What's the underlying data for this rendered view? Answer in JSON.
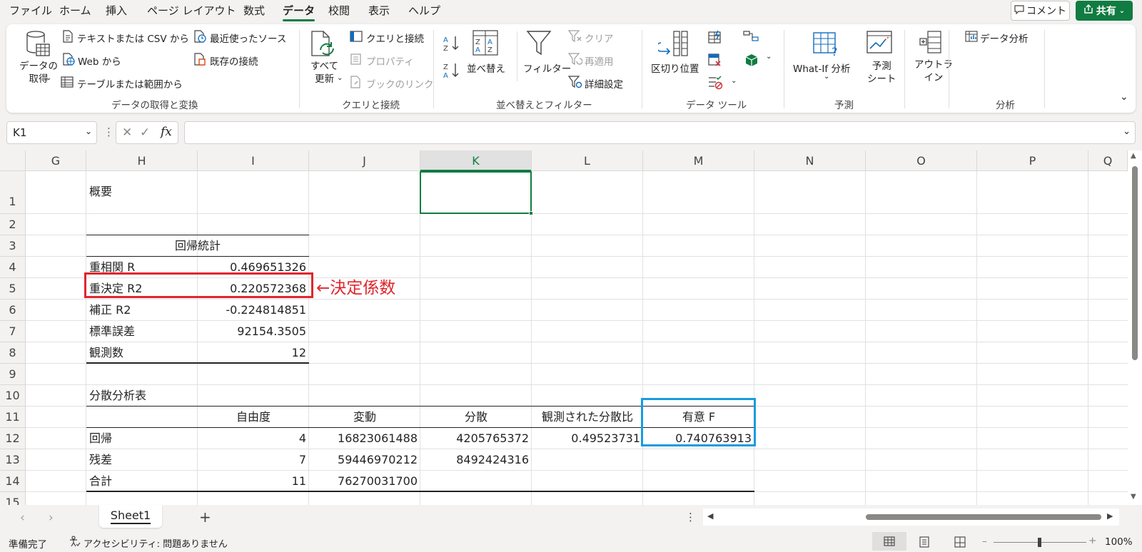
{
  "menu": {
    "items": [
      "ファイル",
      "ホーム",
      "挿入",
      "ページ レイアウト",
      "数式",
      "データ",
      "校閲",
      "表示",
      "ヘルプ"
    ],
    "active": "データ",
    "comment_label": "コメント",
    "share_label": "共有"
  },
  "ribbon": {
    "get_data": "データの\n取得",
    "text_csv": "テキストまたは CSV から",
    "web": "Web から",
    "table_range": "テーブルまたは範囲から",
    "recent_sources": "最近使ったソース",
    "existing_connections": "既存の接続",
    "group_get_transform": "データの取得と変換",
    "refresh_all": "すべて\n更新",
    "queries_connections": "クエリと接続",
    "properties": "プロパティ",
    "workbook_links": "ブックのリンク",
    "group_queries": "クエリと接続",
    "sort": "並べ替え",
    "filter": "フィルター",
    "clear": "クリア",
    "reapply": "再適用",
    "advanced": "詳細設定",
    "group_sort_filter": "並べ替えとフィルター",
    "text_to_columns": "区切り位置",
    "group_data_tools": "データ ツール",
    "what_if": "What-If 分析",
    "forecast_sheet": "予測\nシート",
    "group_forecast": "予測",
    "outline": "アウトラ\nイン",
    "data_analysis": "データ分析",
    "group_analysis": "分析"
  },
  "formula_bar": {
    "name_box": "K1",
    "fx": "fx",
    "formula": ""
  },
  "columns": [
    "G",
    "H",
    "I",
    "J",
    "K",
    "L",
    "M",
    "N",
    "O",
    "P",
    "Q"
  ],
  "selected_column": "K",
  "rows": [
    "1",
    "2",
    "3",
    "4",
    "5",
    "6",
    "7",
    "8",
    "9",
    "10",
    "11",
    "12",
    "13",
    "14",
    "15"
  ],
  "cells": {
    "h1": "概要",
    "h3": "回帰統計",
    "h4": "重相関 R",
    "i4": "0.469651326",
    "h5": "重決定 R2",
    "i5": "0.220572368",
    "h6": "補正 R2",
    "i6": "-0.224814851",
    "h7": "標準誤差",
    "i7": "92154.3505",
    "h8": "観測数",
    "i8": "12",
    "h10": "分散分析表",
    "i11": "自由度",
    "j11": "変動",
    "k11": "分散",
    "l11": "観測された分散比",
    "m11": "有意 F",
    "h12": "回帰",
    "i12": "4",
    "j12": "16823061488",
    "k12": "4205765372",
    "l12": "0.49523731",
    "m12": "0.740763913",
    "h13": "残差",
    "i13": "7",
    "j13": "59446970212",
    "k13": "8492424316",
    "h14": "合計",
    "i14": "11",
    "j14": "76270031700"
  },
  "annotation": {
    "text": "←決定係数",
    "red": "#e0262e",
    "blue": "#1a9be0"
  },
  "sheet_tab": "Sheet1",
  "status": {
    "ready": "準備完了",
    "accessibility": "アクセシビリティ: 問題ありません",
    "zoom": "100%"
  },
  "colors": {
    "accent": "#107c41"
  }
}
